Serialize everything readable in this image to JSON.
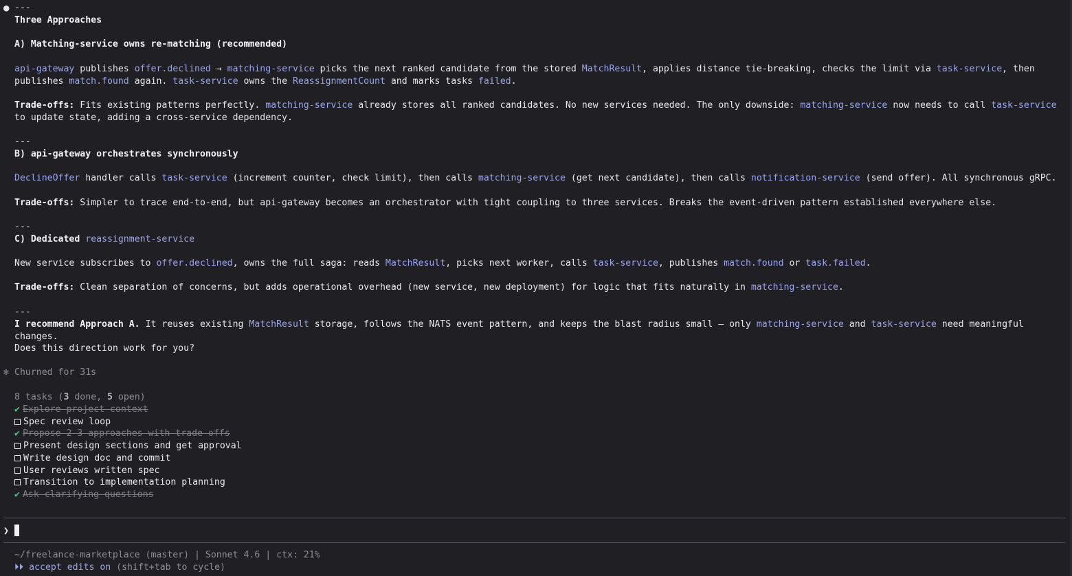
{
  "divider": "---",
  "heading": "Three Approaches",
  "approach_a": {
    "title": "A) Matching-service owns re-matching (recommended)",
    "body": [
      {
        "t": "api-gateway",
        "k": "c"
      },
      {
        "t": " publishes "
      },
      {
        "t": "offer.declined",
        "k": "c"
      },
      {
        "t": " → "
      },
      {
        "t": "matching-service",
        "k": "c"
      },
      {
        "t": " picks the next ranked candidate from the stored "
      },
      {
        "t": "MatchResult",
        "k": "c"
      },
      {
        "t": ", applies distance tie-breaking, checks the limit via "
      },
      {
        "t": "task-service",
        "k": "c"
      },
      {
        "t": ", then publishes "
      },
      {
        "t": "match.found",
        "k": "c"
      },
      {
        "t": " again. "
      },
      {
        "t": "task-service",
        "k": "c"
      },
      {
        "t": " owns the "
      },
      {
        "t": "ReassignmentCount",
        "k": "c"
      },
      {
        "t": " and marks tasks "
      },
      {
        "t": "failed",
        "k": "c"
      },
      {
        "t": "."
      }
    ],
    "tradeoffs": [
      {
        "t": "Trade-offs:",
        "k": "b"
      },
      {
        "t": " Fits existing patterns perfectly. "
      },
      {
        "t": "matching-service",
        "k": "c"
      },
      {
        "t": " already stores all ranked candidates. No new services needed. The only downside: "
      },
      {
        "t": "matching-service",
        "k": "c"
      },
      {
        "t": " now needs to call "
      },
      {
        "t": "task-service",
        "k": "c"
      },
      {
        "t": " to update state, adding a cross-service dependency."
      }
    ]
  },
  "approach_b": {
    "title": "B) api-gateway orchestrates synchronously",
    "body": [
      {
        "t": "DeclineOffer",
        "k": "c"
      },
      {
        "t": " handler calls "
      },
      {
        "t": "task-service",
        "k": "c"
      },
      {
        "t": " (increment counter, check limit), then calls "
      },
      {
        "t": "matching-service",
        "k": "c"
      },
      {
        "t": " (get next candidate), then calls "
      },
      {
        "t": "notification-service",
        "k": "c"
      },
      {
        "t": " (send offer). All synchronous gRPC."
      }
    ],
    "tradeoffs": [
      {
        "t": "Trade-offs:",
        "k": "b"
      },
      {
        "t": " Simpler to trace end-to-end, but api-gateway becomes an orchestrator with tight coupling to three services. Breaks the event-driven pattern established everywhere else."
      }
    ]
  },
  "approach_c": {
    "title": [
      {
        "t": "C) Dedicated ",
        "k": "b"
      },
      {
        "t": "reassignment-service",
        "k": "c"
      }
    ],
    "body": [
      {
        "t": "New service subscribes to "
      },
      {
        "t": "offer.declined",
        "k": "c"
      },
      {
        "t": ", owns the full saga: reads "
      },
      {
        "t": "MatchResult",
        "k": "c"
      },
      {
        "t": ", picks next worker, calls "
      },
      {
        "t": "task-service",
        "k": "c"
      },
      {
        "t": ", publishes "
      },
      {
        "t": "match.found",
        "k": "c"
      },
      {
        "t": " or "
      },
      {
        "t": "task.failed",
        "k": "c"
      },
      {
        "t": "."
      }
    ],
    "tradeoffs": [
      {
        "t": "Trade-offs:",
        "k": "b"
      },
      {
        "t": " Clean separation of concerns, but adds operational overhead (new service, new deployment) for logic that fits naturally in "
      },
      {
        "t": "matching-service",
        "k": "c"
      },
      {
        "t": "."
      }
    ]
  },
  "recommendation": [
    {
      "t": "I recommend Approach A.",
      "k": "b"
    },
    {
      "t": " It reuses existing "
    },
    {
      "t": "MatchResult",
      "k": "c"
    },
    {
      "t": " storage, follows the NATS event pattern, and keeps the blast radius small — only "
    },
    {
      "t": "matching-service",
      "k": "c"
    },
    {
      "t": " and "
    },
    {
      "t": "task-service",
      "k": "c"
    },
    {
      "t": " need meaningful changes."
    }
  ],
  "question": "Does this direction work for you?",
  "churned": "Churned for 31s",
  "tasks_summary": {
    "prefix": "8 tasks (",
    "done_count": "3",
    "done_word": " done, ",
    "open_count": "5",
    "open_word": " open)"
  },
  "tasks": [
    {
      "label": "Explore project context",
      "done": true
    },
    {
      "label": "Spec review loop",
      "done": false
    },
    {
      "label": "Propose 2-3 approaches with trade-offs",
      "done": true
    },
    {
      "label": "Present design sections and get approval",
      "done": false
    },
    {
      "label": "Write design doc and commit",
      "done": false
    },
    {
      "label": "User reviews written spec",
      "done": false
    },
    {
      "label": "Transition to implementation planning",
      "done": false
    },
    {
      "label": "Ask clarifying questions",
      "done": true
    }
  ],
  "prompt_char": "❯",
  "status_line": "~/freelance-marketplace (master) | Sonnet 4.6 | ctx: 21%",
  "mode": {
    "arrows": "⏵⏵",
    "on": "accept edits on",
    "hint": " (shift+tab to cycle)"
  },
  "colors": {
    "background": "#1f1f24",
    "accent": "#9aa4ef",
    "done_check": "#55c48a",
    "muted": "#8d8d96"
  }
}
